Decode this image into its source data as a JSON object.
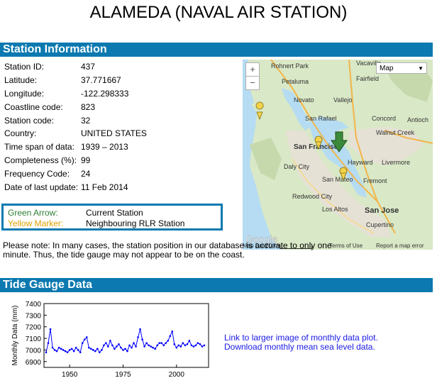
{
  "page": {
    "title": "ALAMEDA (NAVAL AIR STATION)"
  },
  "station_section": {
    "heading": "Station Information",
    "rows": [
      {
        "label": "Station ID:",
        "value": "437"
      },
      {
        "label": "Latitude:",
        "value": "37.771667"
      },
      {
        "label": "Longitude:",
        "value": "-122.298333"
      },
      {
        "label": "Coastline code:",
        "value": "823"
      },
      {
        "label": "Station code:",
        "value": "32"
      },
      {
        "label": "Country:",
        "value": "UNITED STATES"
      },
      {
        "label": "Time span of data:",
        "value": "1939 – 2013"
      },
      {
        "label": "Completeness (%):",
        "value": "99"
      },
      {
        "label": "Frequency Code:",
        "value": "24"
      },
      {
        "label": "Date of last update:",
        "value": "11 Feb 2014"
      }
    ],
    "legend": [
      {
        "label": "Green Arrow:",
        "value": "Current Station",
        "color": "#2e7d32"
      },
      {
        "label": "Yellow Marker:",
        "value": "Neighbouring RLR Station",
        "color": "#e0a000"
      }
    ],
    "note": "Please note: In many cases, the station position in our database is accurate to only one minute. Thus, the tide gauge may not appear to be on the coast."
  },
  "map": {
    "zoom_in": "+",
    "zoom_out": "−",
    "type_select": "Map",
    "footer": {
      "brand": "Google",
      "data": "Map Data",
      "scale": "20 km",
      "terms": "Terms of Use",
      "report": "Report a map error"
    },
    "places": [
      {
        "name": "Rohnert Park"
      },
      {
        "name": "Vacaville"
      },
      {
        "name": "Petaluma"
      },
      {
        "name": "Fairfield"
      },
      {
        "name": "Novato"
      },
      {
        "name": "Vallejo"
      },
      {
        "name": "San Rafael"
      },
      {
        "name": "Concord"
      },
      {
        "name": "Antioch"
      },
      {
        "name": "Walnut Creek"
      },
      {
        "name": "San Francisco"
      },
      {
        "name": "Daly City"
      },
      {
        "name": "Hayward"
      },
      {
        "name": "Livermore"
      },
      {
        "name": "San Mateo"
      },
      {
        "name": "Fremont"
      },
      {
        "name": "Redwood City"
      },
      {
        "name": "Los Altos"
      },
      {
        "name": "San Jose"
      },
      {
        "name": "Cupertino"
      }
    ]
  },
  "tide_section": {
    "heading": "Tide Gauge Data",
    "link_plot": "Link to larger image of monthly data plot.",
    "link_download": "Download monthly mean sea level data."
  },
  "chart_data": {
    "type": "line",
    "title": "",
    "xlabel": "",
    "ylabel": "Monthly Data (mm)",
    "xlim": [
      1938,
      2015
    ],
    "ylim": [
      6850,
      7400
    ],
    "xticks": [
      1950,
      1975,
      2000
    ],
    "yticks": [
      6900,
      7000,
      7100,
      7200,
      7300,
      7400
    ],
    "grid": false,
    "series": [
      {
        "color": "#0000ff",
        "x": [
          1939,
          1940,
          1941,
          1942,
          1943,
          1944,
          1945,
          1946,
          1947,
          1948,
          1949,
          1950,
          1951,
          1952,
          1953,
          1954,
          1955,
          1956,
          1957,
          1958,
          1959,
          1960,
          1961,
          1962,
          1963,
          1964,
          1965,
          1966,
          1967,
          1968,
          1969,
          1970,
          1971,
          1972,
          1973,
          1974,
          1975,
          1976,
          1977,
          1978,
          1979,
          1980,
          1981,
          1982,
          1983,
          1984,
          1985,
          1986,
          1987,
          1988,
          1989,
          1990,
          1991,
          1992,
          1993,
          1994,
          1995,
          1996,
          1997,
          1998,
          1999,
          2000,
          2001,
          2002,
          2003,
          2004,
          2005,
          2006,
          2007,
          2008,
          2009,
          2010,
          2011,
          2012,
          2013
        ],
        "y": [
          6980,
          7060,
          7180,
          7020,
          7000,
          6990,
          7020,
          7010,
          7000,
          6990,
          6980,
          7000,
          7010,
          6990,
          7020,
          7000,
          6980,
          7060,
          7090,
          7110,
          7020,
          7010,
          7000,
          6990,
          7010,
          6980,
          7000,
          7040,
          7060,
          7030,
          7080,
          7040,
          7010,
          7030,
          7050,
          7020,
          7000,
          7010,
          6990,
          7040,
          7020,
          7060,
          7030,
          7110,
          7180,
          7090,
          7030,
          7060,
          7040,
          7030,
          7020,
          7010,
          7040,
          7060,
          7060,
          7040,
          7060,
          7080,
          7120,
          7160,
          7050,
          7020,
          7040,
          7030,
          7060,
          7040,
          7050,
          7080,
          7040,
          7030,
          7040,
          7060,
          7050,
          7030,
          7040
        ]
      }
    ]
  }
}
